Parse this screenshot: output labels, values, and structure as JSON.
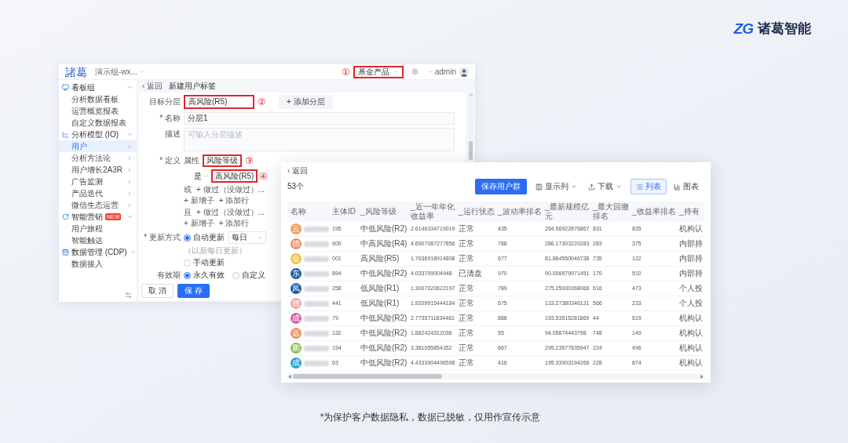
{
  "logo": {
    "mark": "ZG",
    "name": "诸葛智能"
  },
  "segment_window": {
    "brand": "諸葛",
    "project": "演示组-wx...",
    "product_selector": {
      "marker": "①",
      "value": "基金产品",
      "highlighted": true
    },
    "user": "admin",
    "breadcrumb": {
      "back": "‹ 返回",
      "title": "新建用户标签"
    },
    "sidebar": {
      "groups": [
        {
          "label": "看板组",
          "expanded": true,
          "children": [
            {
              "label": "分析数据看板",
              "selected": false
            },
            {
              "label": "运营概览报表",
              "selected": false
            },
            {
              "label": "自定义数据报表",
              "selected": false
            }
          ]
        },
        {
          "label": "分析模型 (IO)",
          "expanded": true,
          "children": [
            {
              "label": "用户",
              "selected": true,
              "expanded": false
            },
            {
              "label": "分析方法论",
              "selected": false,
              "expanded": false
            },
            {
              "label": "用户增长2A3R",
              "selected": false,
              "expanded": false
            },
            {
              "label": "广告监测",
              "selected": false,
              "expanded": false
            },
            {
              "label": "产品迭代",
              "selected": false,
              "expanded": false
            },
            {
              "label": "微信生态运营",
              "selected": false,
              "expanded": false
            }
          ]
        },
        {
          "label": "智能营销",
          "badge": "NEW",
          "expanded": true,
          "children": [
            {
              "label": "用户旅程",
              "selected": false
            },
            {
              "label": "智能触达",
              "selected": false
            }
          ]
        },
        {
          "label": "数据管理 (CDP)",
          "expanded": true,
          "children": [
            {
              "label": "数据接入",
              "selected": false
            }
          ]
        }
      ]
    },
    "form": {
      "layer": {
        "label": "目标分层",
        "value": "高风险(R5)",
        "highlighted": true,
        "marker": "②",
        "add_button": "+ 添加分层"
      },
      "name": {
        "label": "* 名称",
        "value": "分层1"
      },
      "description": {
        "label": "描述",
        "placeholder": "可输入分层描述"
      },
      "definition": {
        "label": "* 定义",
        "property_label": "属性",
        "property": {
          "value": "风险等级",
          "highlighted": true,
          "marker": "③"
        },
        "operator": "是",
        "target": {
          "value": "高风险(R5)",
          "highlighted": true,
          "marker": "④"
        },
        "rows": [
          {
            "connector": "或",
            "actions": [
              "+ 做过（没做过）...",
              "+ 新增子",
              "+ 添加行"
            ]
          },
          {
            "connector": "且",
            "actions": [
              "+ 做过（没做过）...",
              "+ 新增子",
              "+ 添加行"
            ]
          }
        ]
      },
      "update": {
        "label": "* 更新方式",
        "options": [
          {
            "label": "自动更新",
            "selected": true
          },
          {
            "label": "手动更新",
            "selected": false
          }
        ],
        "frequency": "每日",
        "note": "（以后每日更新）"
      },
      "validity": {
        "label": "有效期",
        "options": [
          {
            "label": "永久有效",
            "selected": true
          },
          {
            "label": "自定义",
            "selected": false
          }
        ]
      },
      "buttons": [
        {
          "label": "取 消",
          "kind": "default"
        },
        {
          "label": "保 存",
          "kind": "primary"
        }
      ]
    }
  },
  "result_window": {
    "back": "‹ 返回",
    "count": "53个",
    "actions": [
      {
        "label": "保存用户群",
        "kind": "primary"
      },
      {
        "label": "显示列",
        "kind": "columns"
      },
      {
        "label": "下载",
        "kind": "download"
      }
    ],
    "views": [
      {
        "label": "列表",
        "kind": "list",
        "selected": true
      },
      {
        "label": "图表",
        "kind": "chart",
        "selected": false
      }
    ],
    "table": {
      "columns": [
        "名称",
        "主体ID",
        "_风险等级",
        "_近一年年化收益率",
        "_运行状态",
        "_波动率排名",
        "_最新规模亿元",
        "_最大回撤排名",
        "_收益率排名",
        "_持有"
      ],
      "rows": [
        {
          "cells": [
            {
              "avatar": "云",
              "color": "#f0a05a"
            },
            "195",
            "中低风险(R2)",
            "2.6146334719019",
            "正常",
            "435",
            "264.56922876867",
            "831",
            "835",
            "机构认"
          ]
        },
        {
          "cells": [
            {
              "avatar": "德",
              "color": "#e98f6c"
            },
            "600",
            "中高风险(R4)",
            "4.6907087277856",
            "正常",
            "788",
            "286.17303220283",
            "283",
            "375",
            "内部持"
          ]
        },
        {
          "cells": [
            {
              "avatar": "金",
              "color": "#f2c14e"
            },
            "001",
            "高风险(R5)",
            "1.7636918914808",
            "正常",
            "677",
            "81.864550046738",
            "735",
            "122",
            "内部持"
          ]
        },
        {
          "cells": [
            {
              "avatar": "东",
              "color": "#1f5fa6"
            },
            "894",
            "中低风险(R2)",
            "4.033709004948",
            "已清盘",
            "970",
            "90.006979971451",
            "170",
            "510",
            "内部持"
          ]
        },
        {
          "cells": [
            {
              "avatar": "凤",
              "color": "#1f5fa6"
            },
            "258",
            "低风险(R1)",
            "1.3007020622197",
            "正常",
            "789",
            "275.25930368066",
            "616",
            "473",
            "个人投"
          ]
        },
        {
          "cells": [
            {
              "avatar": "德",
              "color": "#f0a3a8"
            },
            "441",
            "低风险(R1)",
            "1.9209915444184",
            "正常",
            "675",
            "133.27380346121",
            "566",
            "233",
            "个人投"
          ]
        },
        {
          "cells": [
            {
              "avatar": "成",
              "color": "#d65f9f"
            },
            "79",
            "中低风险(R2)",
            "2.7735711834461",
            "正常",
            "886",
            "193.53515281869",
            "44",
            "619",
            "机构认"
          ]
        },
        {
          "cells": [
            {
              "avatar": "远",
              "color": "#ec905c"
            },
            "132",
            "中低风险(R2)",
            "1.882424312036",
            "正常",
            "55",
            "94.05874443798",
            "748",
            "149",
            "机构认"
          ]
        },
        {
          "cells": [
            {
              "avatar": "鹏",
              "color": "#8cc04c"
            },
            "194",
            "中低风险(R2)",
            "3.381055854352",
            "正常",
            "667",
            "295.23577835947",
            "224",
            "496",
            "机构认"
          ]
        },
        {
          "cells": [
            {
              "avatar": "成",
              "color": "#2a9fd6"
            },
            "63",
            "中低风险(R2)",
            "4.4333904496598",
            "正常",
            "416",
            "195.33903194266",
            "228",
            "874",
            "机构认"
          ]
        }
      ]
    }
  },
  "caption": "*为保护客户数据隐私，数据已脱敏，仅用作宣传示意"
}
